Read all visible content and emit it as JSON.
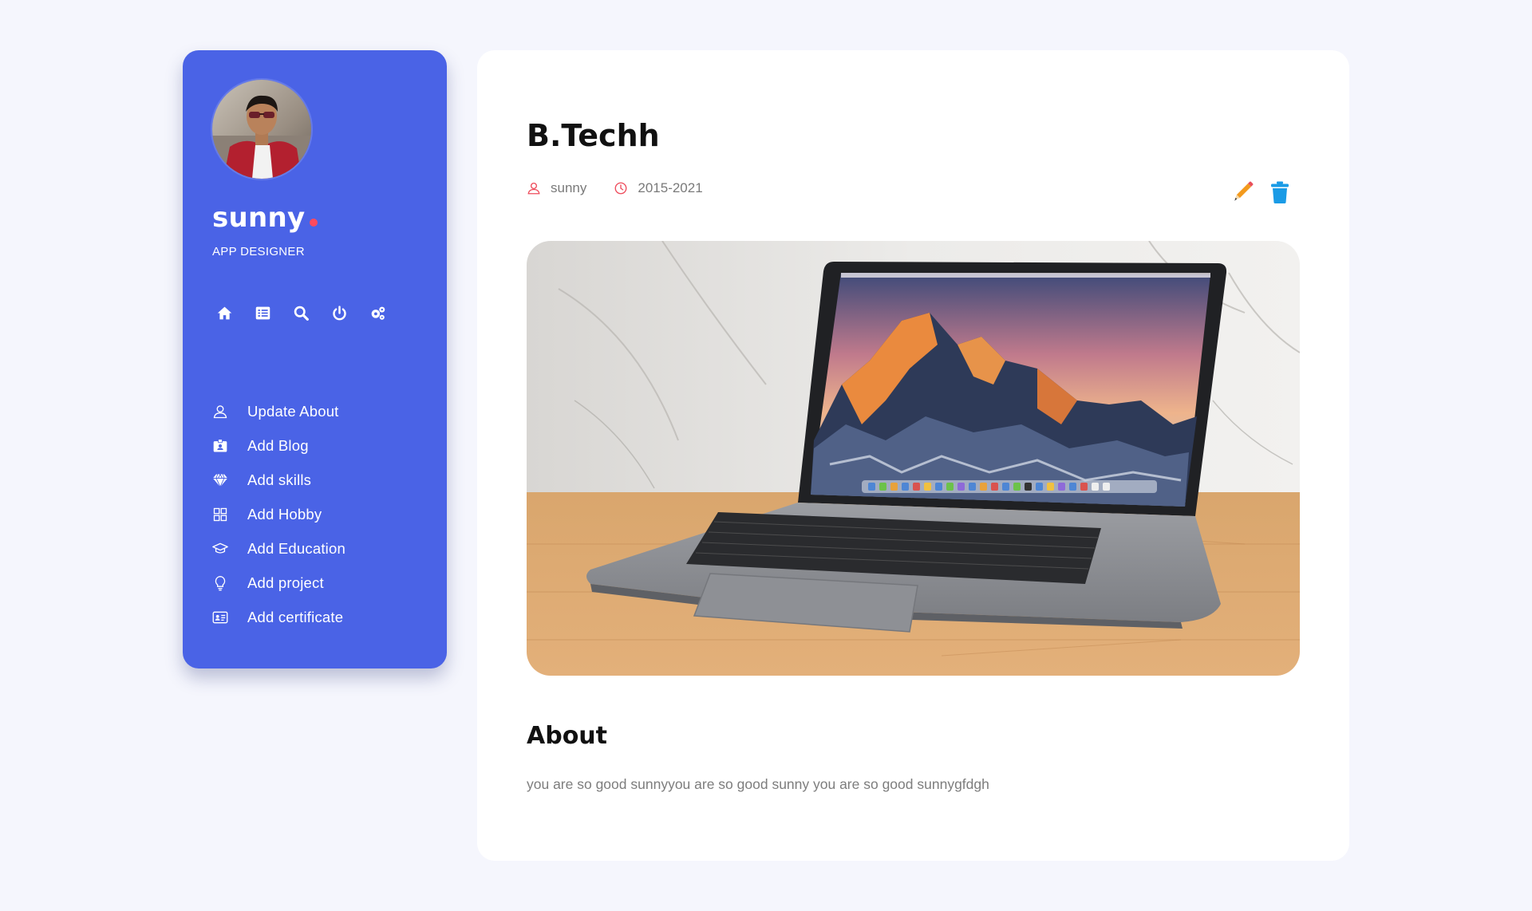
{
  "profile": {
    "name": "sunny",
    "role": "APP DESIGNER"
  },
  "colors": {
    "sidebar_bg": "#4a63e6",
    "accent_dot": "#ff4a5e",
    "page_bg": "#f5f6fd",
    "meta_icon": "#ee4c5c",
    "edit_icon": "#f39a1d",
    "delete_icon": "#1a9be6"
  },
  "icon_bar": [
    {
      "icon": "home-icon"
    },
    {
      "icon": "list-icon"
    },
    {
      "icon": "search-icon"
    },
    {
      "icon": "power-icon"
    },
    {
      "icon": "gears-icon"
    }
  ],
  "menu": [
    {
      "label": "Update About",
      "icon": "user-icon"
    },
    {
      "label": "Add Blog",
      "icon": "id-badge-icon"
    },
    {
      "label": "Add skills",
      "icon": "diamond-icon"
    },
    {
      "label": "Add Hobby",
      "icon": "grid-icon"
    },
    {
      "label": "Add Education",
      "icon": "graduation-cap-icon"
    },
    {
      "label": "Add project",
      "icon": "lightbulb-icon"
    },
    {
      "label": "Add certificate",
      "icon": "id-card-icon"
    }
  ],
  "post": {
    "title": "B.Techh",
    "author": "sunny",
    "period": "2015-2021",
    "image_icon": "laptop-image",
    "about_title": "About",
    "about_text": "you are so good sunnyyou are so good sunny you are so good sunnygfdgh"
  }
}
